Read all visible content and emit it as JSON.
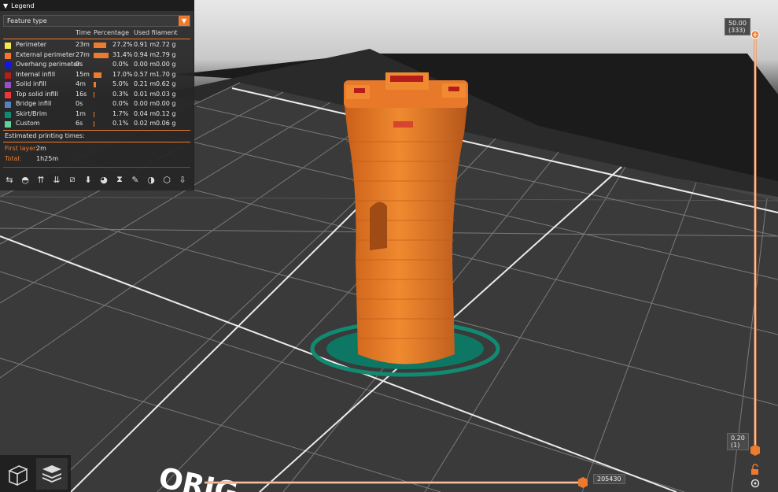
{
  "legend": {
    "title": "Legend",
    "view_type": "Feature type",
    "columns": [
      "Time",
      "Percentage",
      "Used filament"
    ],
    "rows": [
      {
        "name": "Perimeter",
        "color": "#f7e64d",
        "time": "23m",
        "pct": "27.2%",
        "len": "0.91 m",
        "wt": "2.72 g",
        "bar": 27.2
      },
      {
        "name": "External perimeter",
        "color": "#f5772f",
        "time": "27m",
        "pct": "31.4%",
        "len": "0.94 m",
        "wt": "2.79 g",
        "bar": 31.4
      },
      {
        "name": "Overhang perimeter",
        "color": "#0f18e6",
        "time": "0s",
        "pct": "0.0%",
        "len": "0.00 m",
        "wt": "0.00 g",
        "bar": 0
      },
      {
        "name": "Internal infill",
        "color": "#b51d1d",
        "time": "15m",
        "pct": "17.0%",
        "len": "0.57 m",
        "wt": "1.70 g",
        "bar": 17.0
      },
      {
        "name": "Solid infill",
        "color": "#9b4fc7",
        "time": "4m",
        "pct": "5.0%",
        "len": "0.21 m",
        "wt": "0.62 g",
        "bar": 5.0
      },
      {
        "name": "Top solid infill",
        "color": "#f2353a",
        "time": "16s",
        "pct": "0.3%",
        "len": "0.01 m",
        "wt": "0.03 g",
        "bar": 0.3
      },
      {
        "name": "Bridge infill",
        "color": "#5a7fc1",
        "time": "0s",
        "pct": "0.0%",
        "len": "0.00 m",
        "wt": "0.00 g",
        "bar": 0
      },
      {
        "name": "Skirt/Brim",
        "color": "#108a74",
        "time": "1m",
        "pct": "1.7%",
        "len": "0.04 m",
        "wt": "0.12 g",
        "bar": 1.7
      },
      {
        "name": "Custom",
        "color": "#5ed49a",
        "time": "6s",
        "pct": "0.1%",
        "len": "0.02 m",
        "wt": "0.06 g",
        "bar": 0.1
      }
    ],
    "estimated_title": "Estimated printing times:",
    "first_layer_label": "First layer:",
    "first_layer_value": "2m",
    "total_label": "Total:",
    "total_value": "1h25m"
  },
  "vertical_slider": {
    "top_value": "50.00",
    "top_layer": "(333)",
    "bottom_value": "0.20",
    "bottom_layer": "(1)"
  },
  "horizontal_slider": {
    "value": "205430"
  },
  "colors": {
    "accent": "#ec7b30",
    "model": "#e3782b",
    "brim": "#118a72"
  }
}
